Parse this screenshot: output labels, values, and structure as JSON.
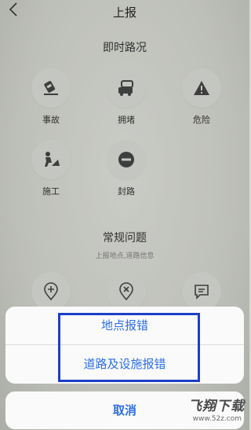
{
  "header": {
    "title": "上报",
    "back_icon": "chevron-left-icon"
  },
  "realtime": {
    "title": "即时路况",
    "items": [
      {
        "label": "事故",
        "icon": "accident-icon"
      },
      {
        "label": "拥堵",
        "icon": "congestion-icon"
      },
      {
        "label": "危险",
        "icon": "danger-icon"
      },
      {
        "label": "施工",
        "icon": "construction-icon"
      },
      {
        "label": "封路",
        "icon": "road-closed-icon"
      }
    ]
  },
  "regular": {
    "title": "常规问题",
    "subtitle": "上报地点,道路信息",
    "items": [
      {
        "icon": "add-location-icon"
      },
      {
        "icon": "remove-location-icon"
      },
      {
        "icon": "feedback-icon"
      }
    ]
  },
  "action_sheet": {
    "options": [
      "地点报错",
      "道路及设施报错"
    ],
    "cancel": "取消",
    "accent_color": "#2d6ee6",
    "highlight_color": "#1d3fc8"
  },
  "watermark": {
    "logo": "飞翔下载",
    "url": "www.52z.com"
  }
}
